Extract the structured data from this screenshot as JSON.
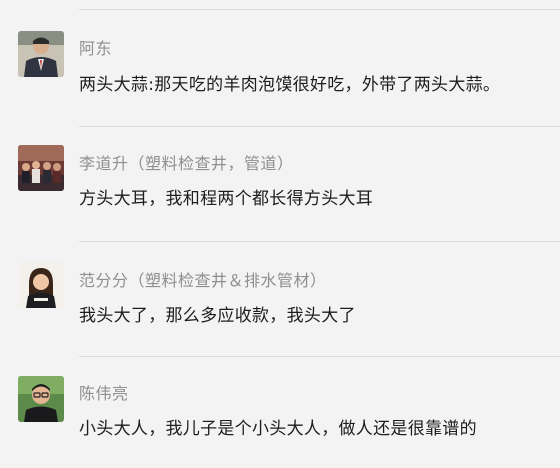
{
  "comments": [
    {
      "author": "阿东",
      "text": "两头大蒜:那天吃的羊肉泡馍很好吃，外带了两头大蒜。",
      "avatar": "avatar-man-suit-icon"
    },
    {
      "author": "李道升（塑料检查井，管道）",
      "text": "方头大耳，我和程两个都长得方头大耳",
      "avatar": "avatar-group-photo-icon"
    },
    {
      "author": "范分分（塑料检查井＆排水管材）",
      "text": "我头大了，那么多应收款，我头大了",
      "avatar": "avatar-woman-icon"
    },
    {
      "author": "陈伟亮",
      "text": "小头大人，我儿子是个小头大人，做人还是很靠谱的",
      "avatar": "avatar-man-glasses-icon"
    }
  ]
}
